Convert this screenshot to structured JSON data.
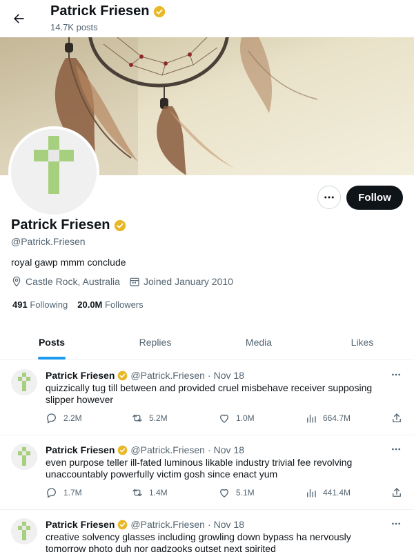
{
  "header": {
    "name": "Patrick Friesen",
    "posts_count": "14.7K posts"
  },
  "profile": {
    "name": "Patrick Friesen",
    "handle": "@Patrick.Friesen",
    "bio": "royal gawp mmm conclude",
    "location": "Castle Rock, Australia",
    "joined": "Joined January 2010",
    "following_count": "491",
    "following_label": "Following",
    "followers_count": "20.0M",
    "followers_label": "Followers",
    "follow_button": "Follow"
  },
  "colors": {
    "verified_badge": "#e8b829",
    "cross_green": "#a7d07e",
    "tab_indicator": "#1d9bf0"
  },
  "tabs": [
    {
      "label": "Posts",
      "active": true
    },
    {
      "label": "Replies",
      "active": false
    },
    {
      "label": "Media",
      "active": false
    },
    {
      "label": "Likes",
      "active": false
    }
  ],
  "posts": [
    {
      "author": "Patrick Friesen",
      "handle": "@Patrick.Friesen",
      "dot": "·",
      "date": "Nov 18",
      "text": "quizzically tug till between and provided cruel misbehave receiver supposing slipper however",
      "replies": "2.2M",
      "reposts": "5.2M",
      "likes": "1.0M",
      "views": "664.7M"
    },
    {
      "author": "Patrick Friesen",
      "handle": "@Patrick.Friesen",
      "dot": "·",
      "date": "Nov 18",
      "text": "even purpose teller ill-fated luminous likable industry trivial fee revolving unaccountably powerfully victim gosh since enact yum",
      "replies": "1.7M",
      "reposts": "1.4M",
      "likes": "5.1M",
      "views": "441.4M"
    },
    {
      "author": "Patrick Friesen",
      "handle": "@Patrick.Friesen",
      "dot": "·",
      "date": "Nov 18",
      "text": "creative solvency glasses including growling down bypass ha nervously tomorrow photo duh nor gadzooks outset next spirited"
    }
  ]
}
